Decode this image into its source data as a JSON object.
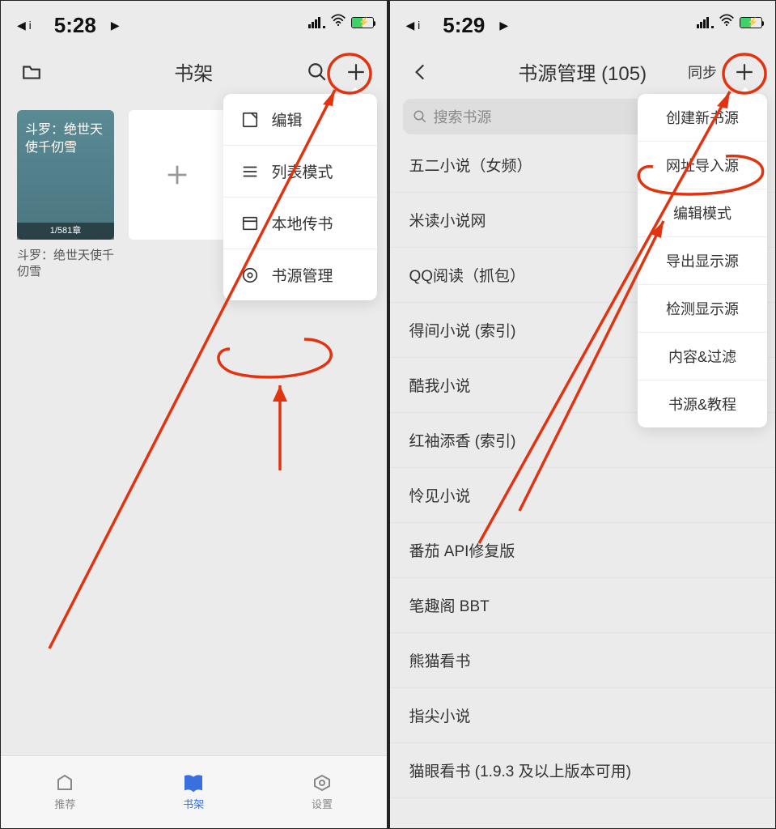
{
  "left": {
    "status": {
      "time": "5:28"
    },
    "header": {
      "title": "书架"
    },
    "book": {
      "cover_title": "斗罗：绝世天使千仞雪",
      "progress": "1/581章",
      "title": "斗罗：绝世天使千仞雪"
    },
    "dropdown": [
      {
        "label": "编辑"
      },
      {
        "label": "列表模式"
      },
      {
        "label": "本地传书"
      },
      {
        "label": "书源管理"
      }
    ],
    "tabs": {
      "recommend": "推荐",
      "shelf": "书架",
      "settings": "设置"
    }
  },
  "right": {
    "status": {
      "time": "5:29"
    },
    "header": {
      "title": "书源管理 (105)",
      "sync": "同步"
    },
    "search": {
      "placeholder": "搜索书源"
    },
    "dropdown": [
      {
        "label": "创建新书源"
      },
      {
        "label": "网址导入源"
      },
      {
        "label": "编辑模式"
      },
      {
        "label": "导出显示源"
      },
      {
        "label": "检测显示源"
      },
      {
        "label": "内容&过滤"
      },
      {
        "label": "书源&教程"
      }
    ],
    "sources": [
      "五二小说（女频）",
      "米读小说网",
      "QQ阅读（抓包）",
      "得间小说 (索引)",
      "酷我小说",
      "红袖添香 (索引)",
      "怜见小说",
      "番茄 API修复版",
      "笔趣阁 BBT",
      "熊猫看书",
      "指尖小说",
      "猫眼看书 (1.9.3 及以上版本可用)"
    ]
  }
}
